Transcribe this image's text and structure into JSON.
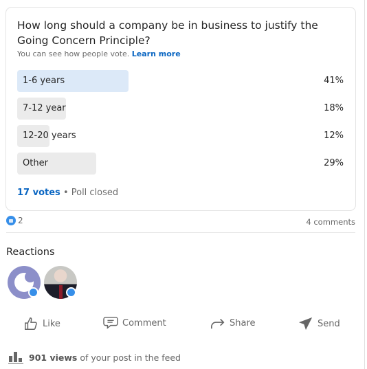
{
  "poll": {
    "question": "How long should a company be in business to justify the Going Concern Principle?",
    "subtitle": "You can see how people vote.",
    "learn_more": "Learn more",
    "options": [
      {
        "label": "1-6 years",
        "percent": 41,
        "pct_text": "41%",
        "selected": true
      },
      {
        "label": "7-12 year",
        "percent": 18,
        "pct_text": "18%",
        "selected": false
      },
      {
        "label": "12-20 years",
        "percent": 12,
        "pct_text": "12%",
        "selected": false
      },
      {
        "label": "Other",
        "percent": 29,
        "pct_text": "29%",
        "selected": false
      }
    ],
    "votes": "17 votes",
    "status": "• Poll closed"
  },
  "social": {
    "reaction_count": "2",
    "comments": "4 comments"
  },
  "reactions": {
    "title": "Reactions"
  },
  "actions": {
    "like": "Like",
    "comment": "Comment",
    "share": "Share",
    "send": "Send"
  },
  "views": {
    "count": "901 views",
    "suffix": "of your post in the feed"
  },
  "colors": {
    "accent": "#0a66c2",
    "selected_fill": "#dce9f8",
    "fill": "#ebebeb"
  }
}
